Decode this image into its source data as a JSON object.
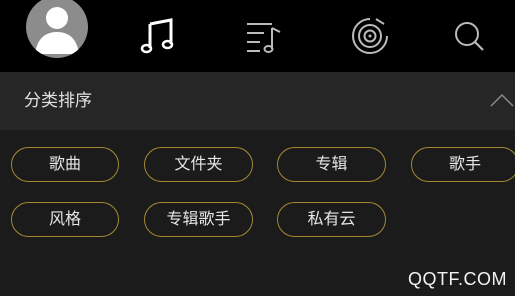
{
  "nav": {
    "avatar": "user-avatar-icon",
    "icons": [
      "music-note-icon",
      "playlist-icon",
      "vinyl-disc-icon",
      "search-icon"
    ]
  },
  "panel": {
    "title": "分类排序",
    "collapse_icon": "chevron-up-icon"
  },
  "categories": [
    "歌曲",
    "文件夹",
    "专辑",
    "歌手",
    "风格",
    "专辑歌手",
    "私有云"
  ],
  "watermark": "QQTF.COM",
  "colors": {
    "accent_border": "#a38a32",
    "header_bg": "#262626",
    "body_bg": "#1b1b1b",
    "topbar_bg": "#000000"
  }
}
